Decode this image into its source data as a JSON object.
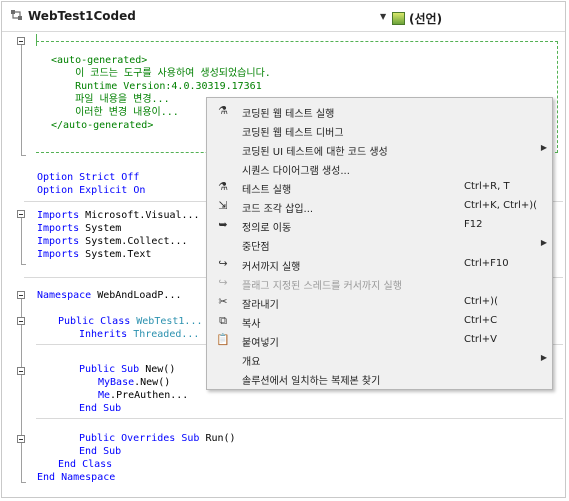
{
  "navbar": {
    "type_name": "WebTest1Coded",
    "member_name": "(선언)"
  },
  "code": {
    "region_lines": [
      "<auto-generated>",
      "    이 코드는 도구를 사용하여 생성되었습니다.",
      "    Runtime Version:4.0.30319.17361",
      "",
      "    파일 내용을 변경...",
      "    이러한 변경 내용이...",
      "</auto-generated>"
    ],
    "option_strict": [
      "Option",
      " Strict",
      " Off"
    ],
    "option_explicit": [
      "Option",
      " Explicit",
      " On"
    ],
    "imports": [
      {
        "kw": "Imports",
        "name": " Microsoft.Visual..."
      },
      {
        "kw": "Imports",
        "name": " System"
      },
      {
        "kw": "Imports",
        "name": " System.Collect..."
      },
      {
        "kw": "Imports",
        "name": " System.Text"
      }
    ],
    "namespace_kw": "Namespace",
    "namespace_name": " WebAndLoadP...",
    "class_kw": "Public Class",
    "class_name": " WebTest1...",
    "inherits_kw": "Inherits",
    "inherits_name": " Threaded...",
    "sub_new_kw": "Public Sub",
    "sub_new_name": " New()",
    "mybase_kw": "MyBase",
    "mybase_rest": ".New()",
    "me_kw": "Me",
    "me_rest": ".PreAuthen...",
    "end_sub_1": "End Sub",
    "run_kw": "Public Overrides Sub",
    "run_name": " Run()",
    "end_sub_2": "End Sub",
    "end_class": "End Class",
    "end_namespace": "End Namespace"
  },
  "context_menu": {
    "items": [
      {
        "icon": "web-test-run-icon",
        "label": "코딩된 웹 테스트 실행",
        "shortcut": "",
        "submenu": false,
        "disabled": false
      },
      {
        "icon": "",
        "label": "코딩된 웹 테스트 디버그",
        "shortcut": "",
        "submenu": false,
        "disabled": false
      },
      {
        "icon": "",
        "label": "코딩된 UI 테스트에 대한 코드 생성",
        "shortcut": "",
        "submenu": true,
        "disabled": false
      },
      {
        "icon": "",
        "label": "시퀀스 다이어그램 생성...",
        "shortcut": "",
        "submenu": false,
        "disabled": false
      },
      {
        "icon": "test-run-icon",
        "label": "테스트 실행",
        "shortcut": "Ctrl+R, T",
        "submenu": false,
        "disabled": false
      },
      {
        "icon": "snippet-icon",
        "label": "코드 조각 삽입...",
        "shortcut": "Ctrl+K, Ctrl+)(",
        "submenu": false,
        "disabled": false
      },
      {
        "icon": "go-to-definition-icon",
        "label": "정의로 이동",
        "shortcut": "F12",
        "submenu": false,
        "disabled": false
      },
      {
        "icon": "",
        "label": "중단점",
        "shortcut": "",
        "submenu": true,
        "disabled": false
      },
      {
        "icon": "run-to-cursor-icon",
        "label": "커서까지 실행",
        "shortcut": "Ctrl+F10",
        "submenu": false,
        "disabled": false
      },
      {
        "icon": "run-flagged-threads-icon",
        "label": "플래그 지정된 스레드를 커서까지 실행",
        "shortcut": "",
        "submenu": false,
        "disabled": true
      },
      {
        "icon": "cut-icon",
        "label": "잘라내기",
        "shortcut": "Ctrl+)(",
        "submenu": false,
        "disabled": false
      },
      {
        "icon": "copy-icon",
        "label": "복사",
        "shortcut": "Ctrl+C",
        "submenu": false,
        "disabled": false
      },
      {
        "icon": "paste-icon",
        "label": "붙여넣기",
        "shortcut": "Ctrl+V",
        "submenu": false,
        "disabled": false
      },
      {
        "icon": "",
        "label": "개요",
        "shortcut": "",
        "submenu": true,
        "disabled": false
      },
      {
        "icon": "",
        "label": "솔루션에서 일치하는 복제본 찾기",
        "shortcut": "",
        "submenu": false,
        "disabled": false
      }
    ]
  }
}
